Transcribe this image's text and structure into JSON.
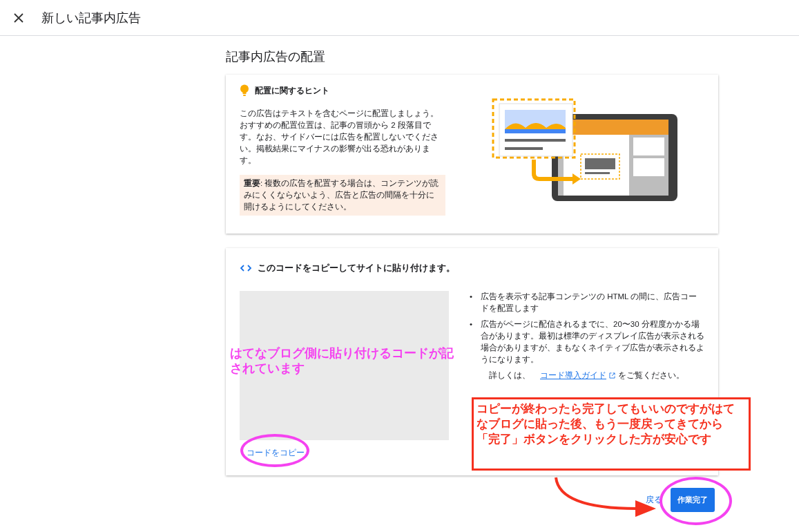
{
  "header": {
    "title": "新しい記事内広告"
  },
  "section_title": "記事内広告の配置",
  "hint_card": {
    "title": "配置に関するヒント",
    "body": "この広告はテキストを含むページに配置しましょう。おすすめの配置位置は、記事の冒頭から 2 段落目です。なお、サイドバーには広告を配置しないでください。掲載結果にマイナスの影響が出る恐れがあります。",
    "notice": "**重要**: 複数の広告を配置する場合は、コンテンツが読みにくくならないよう、広告と広告の間隔を十分に開けるようにしてください。"
  },
  "code_card": {
    "title": "このコードをコピーしてサイトに貼り付けます。",
    "copy_link": "コードをコピー",
    "bullet_marker": "•",
    "bullets": [
      "広告を表示する記事コンテンツの HTML の間に、広告コードを配置します",
      "広告がページに配信されるまでに、20〜30 分程度かかる場合があります。最初は標準のディスプレイ広告が表示される場合がありますが、まもなくネイティブ広告が表示されるようになります。"
    ],
    "more_prefix": "詳しくは、",
    "more_link": "コード導入ガイド",
    "more_suffix": "をご覧ください。"
  },
  "footer": {
    "back": "戻る",
    "done": "作業完了"
  },
  "annotations": {
    "code_note": "はてなブログ側に貼り付けるコードが記されています",
    "done_note": "コピーが終わったら完了してもいいのですがはてなブログに貼った後、もう一度戻ってきてから「完了」ボタンをクリックした方が安心です"
  }
}
